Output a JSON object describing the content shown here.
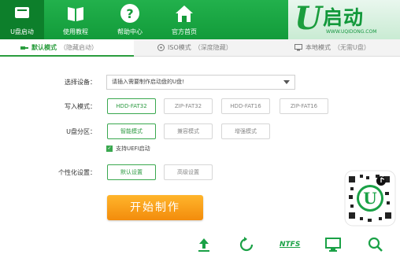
{
  "nav": {
    "items": [
      {
        "label": "U盘启动",
        "icon": "usb-drive-icon",
        "active": true
      },
      {
        "label": "使用教程",
        "icon": "book-icon",
        "active": false
      },
      {
        "label": "帮助中心",
        "icon": "help-icon",
        "active": false
      },
      {
        "label": "官方首页",
        "icon": "home-icon",
        "active": false
      }
    ]
  },
  "logo": {
    "letter": "U",
    "name": "启动",
    "site": "WWW.UQIDONG.COM"
  },
  "tabs": [
    {
      "label": "默认模式",
      "sub": "（隐藏启动）",
      "icon": "usb-plug-icon",
      "active": true
    },
    {
      "label": "ISO模式",
      "sub": "（深度隐藏）",
      "icon": "disc-icon",
      "active": false
    },
    {
      "label": "本地模式",
      "sub": "（无需U盘）",
      "icon": "monitor-icon",
      "active": false
    }
  ],
  "form": {
    "device_label": "选择设备：",
    "device_placeholder": "请插入需要制作启动盘的U盘!",
    "write_mode_label": "写入模式：",
    "write_modes": [
      "HDD-FAT32",
      "ZIP-FAT32",
      "HDD-FAT16",
      "ZIP-FAT16"
    ],
    "write_mode_selected": "HDD-FAT32",
    "partition_label": "U盘分区：",
    "partition_modes": [
      "智能模式",
      "兼容模式",
      "增强模式"
    ],
    "partition_selected": "智能模式",
    "uefi_label": "支持UEFI启动",
    "uefi_checked": true,
    "personalize_label": "个性化设置：",
    "personalize_options": [
      "默认设置",
      "高级设置"
    ],
    "personalize_selected": "默认设置"
  },
  "start_button": "开始制作",
  "bottom_icons": [
    "upload-icon",
    "refresh-icon",
    "ntfs-icon",
    "monitor-icon",
    "search-icon"
  ],
  "bottom_ntfs_text": "NTFS",
  "colors": {
    "brand_green": "#1aa146",
    "accent_orange": "#f39a14"
  }
}
